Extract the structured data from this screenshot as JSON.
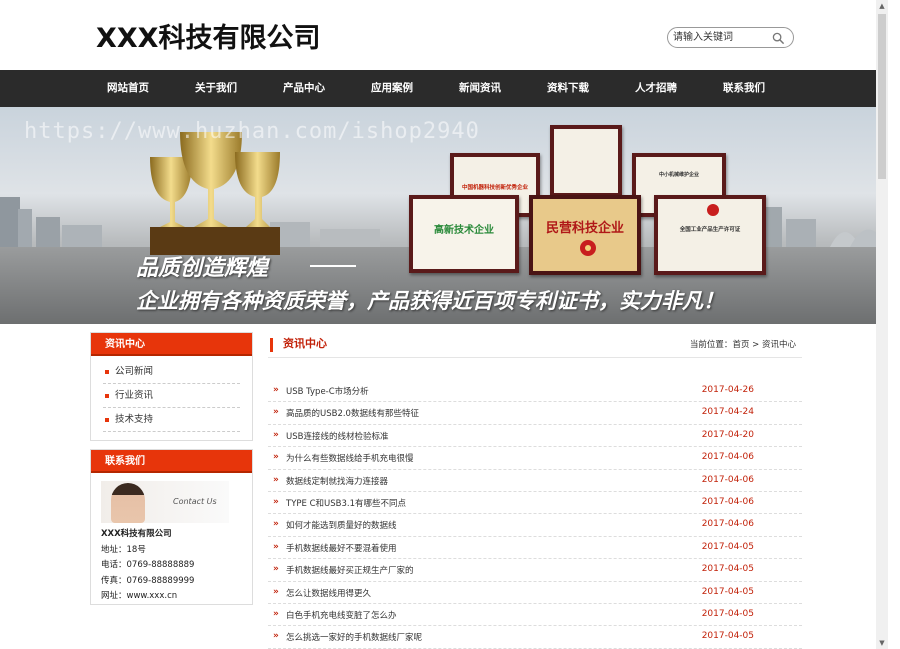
{
  "header": {
    "logo": "XXX科技有限公司",
    "search_placeholder": "请输入关键词"
  },
  "nav": [
    {
      "label": "网站首页"
    },
    {
      "label": "关于我们"
    },
    {
      "label": "产品中心"
    },
    {
      "label": "应用案例"
    },
    {
      "label": "新闻资讯"
    },
    {
      "label": "资料下载"
    },
    {
      "label": "人才招聘"
    },
    {
      "label": "联系我们"
    }
  ],
  "banner": {
    "watermark": "https://www.huzhan.com/ishop2940",
    "slogan1": "品质创造辉煌",
    "slogan2": "企业拥有各种资质荣誉，产品获得近百项专利证书，实力非凡！",
    "certs": [
      "中国机器科技创新优秀企业",
      "中小机械维护企业",
      "高新技术企业",
      "民营科技企业",
      "全国工业产品生产许可证"
    ]
  },
  "sidebar": {
    "news_title": "资讯中心",
    "items": [
      {
        "label": "公司新闻"
      },
      {
        "label": "行业资讯"
      },
      {
        "label": "技术支持"
      }
    ],
    "contact_title": "联系我们",
    "contact_img_text": "Contact Us",
    "company": "XXX科技有限公司",
    "address": "地址：18号",
    "phone": "电话：0769-88888889",
    "fax": "传真：0769-88889999",
    "website": "网址：www.xxx.cn"
  },
  "main": {
    "title": "资讯中心",
    "crumb_prefix": "当前位置：",
    "crumb_home": "首页",
    "crumb_sep": " > ",
    "crumb_current": "资讯中心",
    "news": [
      {
        "title": "USB Type-C市场分析",
        "date": "2017-04-26"
      },
      {
        "title": "高品质的USB2.0数据线有那些特征",
        "date": "2017-04-24"
      },
      {
        "title": "USB连接线的线材检验标准",
        "date": "2017-04-20"
      },
      {
        "title": "为什么有些数据线给手机充电很慢",
        "date": "2017-04-06"
      },
      {
        "title": "数据线定制就找海力连接器",
        "date": "2017-04-06"
      },
      {
        "title": "TYPE C和USB3.1有哪些不同点",
        "date": "2017-04-06"
      },
      {
        "title": "如何才能选到质量好的数据线",
        "date": "2017-04-06"
      },
      {
        "title": "手机数据线最好不要混着使用",
        "date": "2017-04-05"
      },
      {
        "title": "手机数据线最好买正规生产厂家的",
        "date": "2017-04-05"
      },
      {
        "title": "怎么让数据线用得更久",
        "date": "2017-04-05"
      },
      {
        "title": "白色手机充电线变脏了怎么办",
        "date": "2017-04-05"
      },
      {
        "title": "怎么挑选一家好的手机数据线厂家呢",
        "date": "2017-04-05"
      }
    ]
  },
  "colors": {
    "accent": "#e7350b",
    "nav_bg": "#2b2b2b",
    "date": "#c2220a"
  }
}
